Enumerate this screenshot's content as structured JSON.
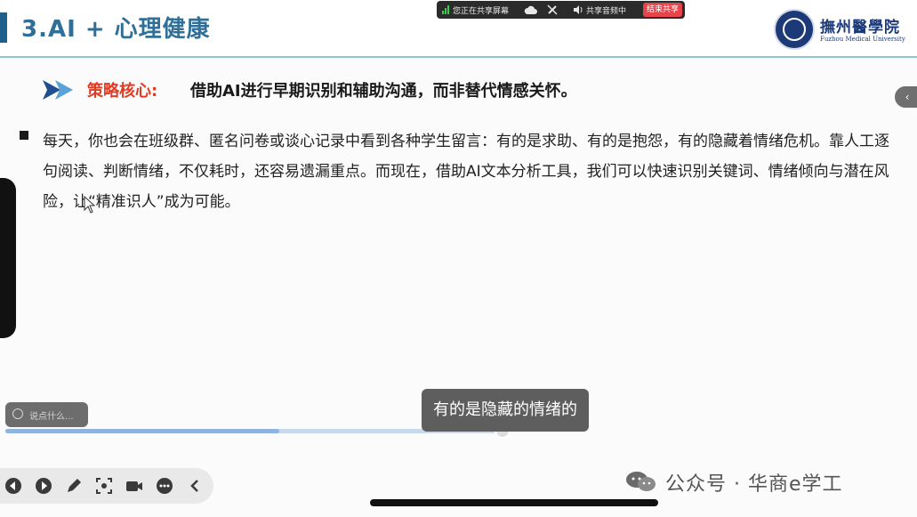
{
  "slide": {
    "title": "3.AI + 心理健康",
    "strategy_label": "策略核心:",
    "strategy_text": "借助AI进行早期识别和辅助沟通，而非替代情感关怀。",
    "paragraph": "每天，你也会在班级群、匿名问卷或谈心记录中看到各种学生留言：有的是求助、有的是抱怨，有的隐藏着情绪危机。靠人工逐句阅读、判断情绪，不仅耗时，还容易遗漏重点。而现在，借助AI文本分析工具，我们可以快速识别关键词、情绪倾向与潜在风险，让“精准识人”成为可能。"
  },
  "logo": {
    "name_cn": "撫州醫學院",
    "name_en": "Fuzhou Medical University"
  },
  "share_toolbar": {
    "status": "您正在共享屏幕",
    "audio": "共享音频中",
    "stop_label": "结束共享"
  },
  "player": {
    "comment_placeholder": "说点什么...",
    "subtitle": "有的是隐藏的情绪的",
    "progress": 0.55
  },
  "watermark": {
    "text": "公众号 · 华商e学工"
  },
  "side": {
    "collapse_glyph": "‹"
  },
  "colors": {
    "title": "#2f6f98",
    "accent_red": "#e03b24",
    "header_line": "#8fc6d6",
    "logo_blue": "#1d3a78",
    "stop_red": "#e6434b"
  },
  "icons": [
    "signal-icon",
    "cloud-icon",
    "no-draw-icon",
    "speaker-icon",
    "arrow-icon",
    "cursor-icon",
    "comment-icon",
    "prev-icon",
    "play-icon",
    "pen-icon",
    "screenshot-icon",
    "camera-icon",
    "more-icon",
    "back-icon",
    "wechat-icon"
  ]
}
